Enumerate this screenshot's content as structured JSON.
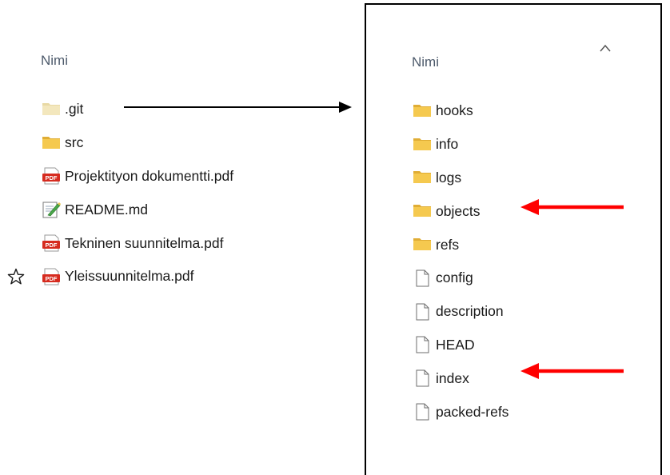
{
  "left_pane": {
    "column_header": "Nimi",
    "items": [
      {
        "name": ".git",
        "type": "folder-faded"
      },
      {
        "name": "src",
        "type": "folder"
      },
      {
        "name": "Projektityon dokumentti.pdf",
        "type": "pdf"
      },
      {
        "name": "README.md",
        "type": "markdown"
      },
      {
        "name": "Tekninen suunnitelma.pdf",
        "type": "pdf"
      },
      {
        "name": "Yleissuunnitelma.pdf",
        "type": "pdf"
      }
    ]
  },
  "right_pane": {
    "column_header": "Nimi",
    "items": [
      {
        "name": "hooks",
        "type": "folder"
      },
      {
        "name": "info",
        "type": "folder"
      },
      {
        "name": "logs",
        "type": "folder"
      },
      {
        "name": "objects",
        "type": "folder"
      },
      {
        "name": "refs",
        "type": "folder"
      },
      {
        "name": "config",
        "type": "file"
      },
      {
        "name": "description",
        "type": "file"
      },
      {
        "name": "HEAD",
        "type": "file"
      },
      {
        "name": "index",
        "type": "file"
      },
      {
        "name": "packed-refs",
        "type": "file"
      }
    ]
  },
  "colors": {
    "folder": "#f5c94f",
    "folder_faded": "#f3e7bd",
    "pdf_red": "#d62b1f",
    "annotation_red": "#ff0000",
    "header_text": "#4d5a6b"
  },
  "icons": {
    "star": "star-outline-icon",
    "sort": "chevron-up-icon"
  }
}
